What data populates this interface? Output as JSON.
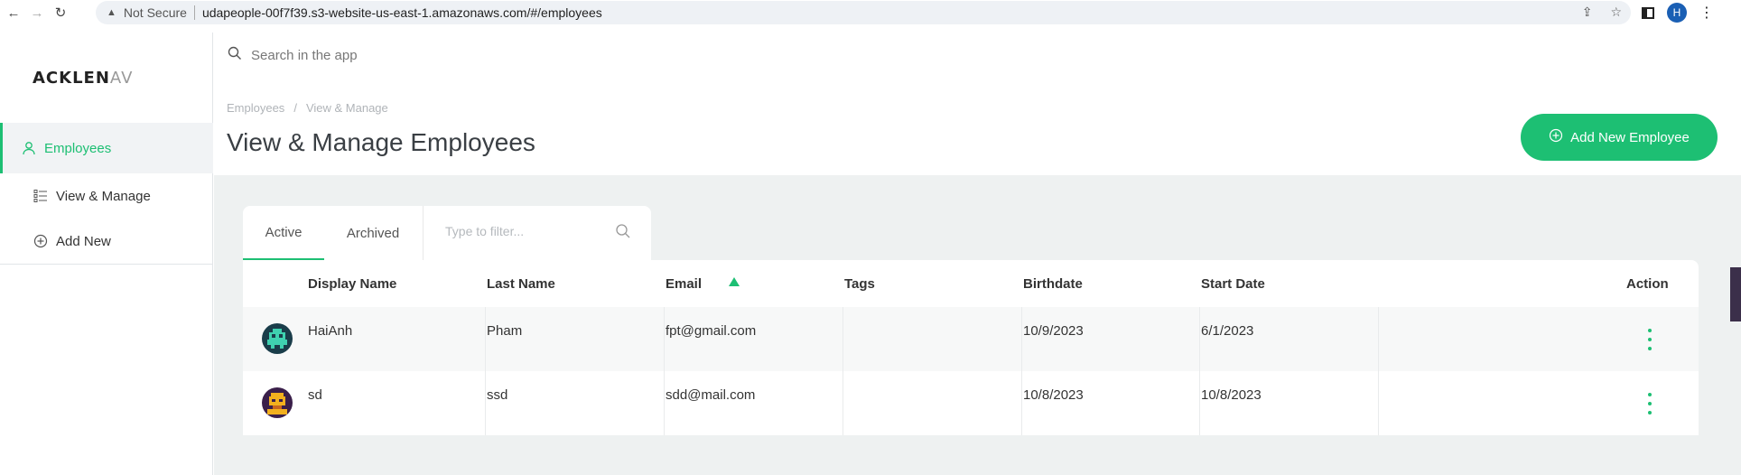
{
  "browser": {
    "security_label": "Not Secure",
    "url": "udapeople-00f7f39.s3-website-us-east-1.amazonaws.com/#/employees",
    "profile_initial": "H"
  },
  "sidebar": {
    "logo_main": "ACKLEN",
    "logo_fade": "AV",
    "items": [
      {
        "label": "Employees",
        "icon": "user-icon",
        "active": true
      },
      {
        "label": "View & Manage",
        "icon": "list-icon",
        "active": false
      },
      {
        "label": "Add New",
        "icon": "plus-circle-icon",
        "active": false
      }
    ]
  },
  "search": {
    "placeholder": "Search in the app"
  },
  "breadcrumb": [
    "Employees",
    "View & Manage"
  ],
  "page_title": "View & Manage Employees",
  "add_button_label": "Add New Employee",
  "tabs": [
    {
      "label": "Active",
      "active": true
    },
    {
      "label": "Archived",
      "active": false
    }
  ],
  "filter": {
    "placeholder": "Type to filter..."
  },
  "table": {
    "columns": [
      "Display Name",
      "Last Name",
      "Email",
      "Tags",
      "Birthdate",
      "Start Date",
      "Action"
    ],
    "sorted_column": "Email",
    "rows": [
      {
        "display_name": "HaiAnh",
        "last_name": "Pham",
        "email": "fpt@gmail.com",
        "tags": "",
        "birthdate": "10/9/2023",
        "start_date": "6/1/2023"
      },
      {
        "display_name": "sd",
        "last_name": "ssd",
        "email": "sdd@mail.com",
        "tags": "",
        "birthdate": "10/8/2023",
        "start_date": "10/8/2023"
      }
    ]
  },
  "colors": {
    "accent": "#1dbf73",
    "content_bg": "#eef1f1"
  }
}
